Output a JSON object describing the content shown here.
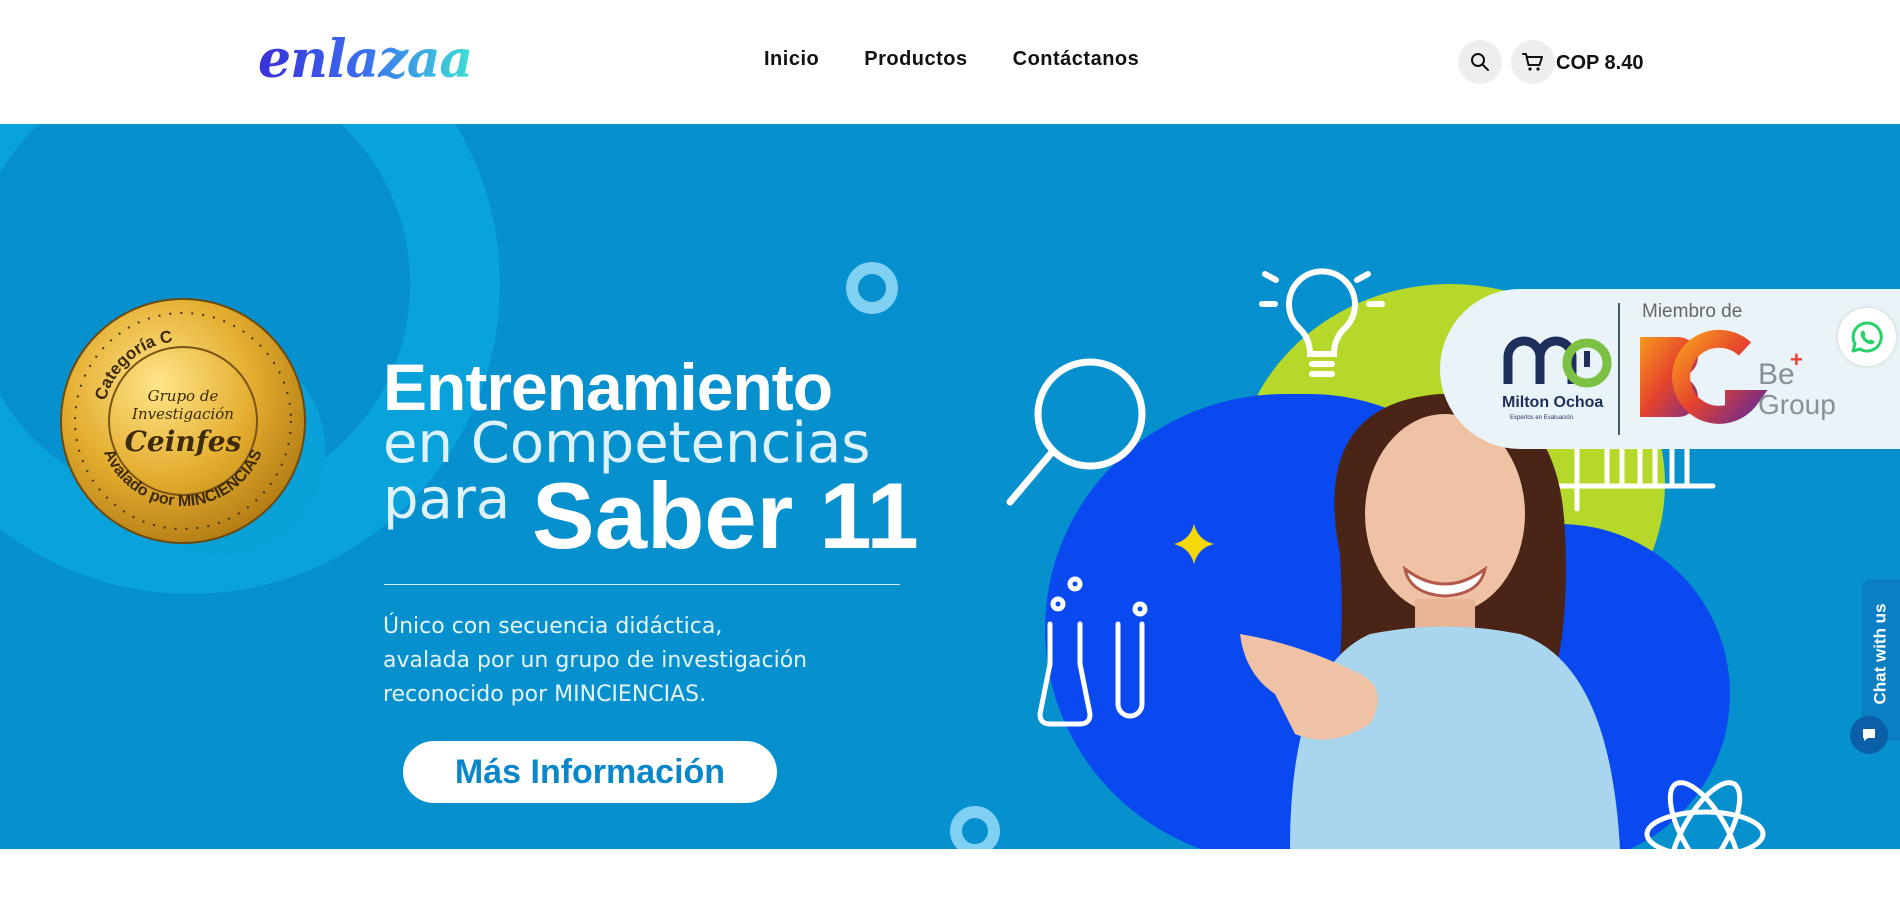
{
  "brand": {
    "logo_text": "enlazaa"
  },
  "nav": {
    "items": [
      {
        "label": "Inicio"
      },
      {
        "label": "Productos"
      },
      {
        "label": "Contáctanos"
      }
    ]
  },
  "header": {
    "search_icon": "search-icon",
    "cart_icon": "cart-icon",
    "cart_total": "COP 8.40"
  },
  "hero": {
    "title_line1": "Entrenamiento",
    "title_line2": "en Competencias",
    "title_line3": "para",
    "title_highlight": "Saber 11",
    "description_lines": [
      "Único con secuencia didáctica,",
      "avalada por un grupo de investigación",
      "reconocido por MINCIENCIAS."
    ],
    "cta_label": "Más Información"
  },
  "badge": {
    "top_text": "Categoría C",
    "middle_line1": "Grupo de",
    "middle_line2": "Investigación",
    "name": "Ceinfes",
    "bottom_text": "Avalado por MINCIENCIAS"
  },
  "partners": {
    "member_label": "Miembro de",
    "mo_name": "Milton Ochoa",
    "mo_tagline": "Expertos en Evaluación",
    "group_name_1": "Be",
    "group_name_2": "Group"
  },
  "chat": {
    "label": "Chat with us"
  },
  "colors": {
    "hero_bg": "#0690cd",
    "cta_text": "#0a87c9",
    "accent_green": "#b5d82a",
    "accent_blue": "#0a49f0"
  }
}
